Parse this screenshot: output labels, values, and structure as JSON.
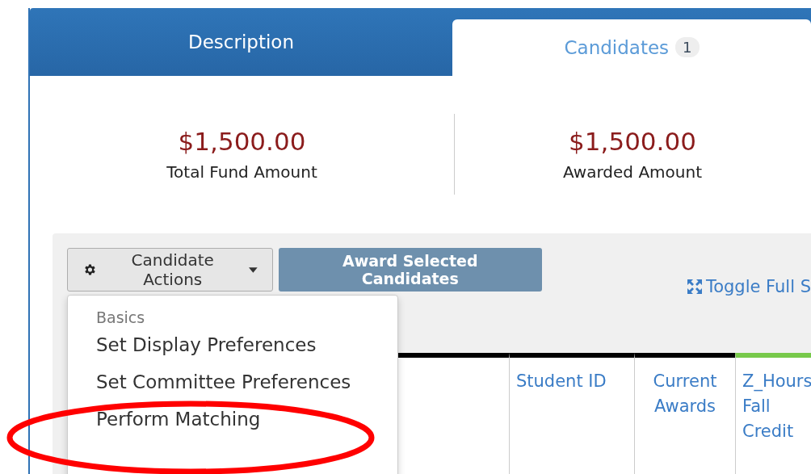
{
  "tabs": [
    {
      "label": "Description",
      "selected": false
    },
    {
      "label": "Candidates",
      "selected": true,
      "badge": "1"
    }
  ],
  "stats": [
    {
      "amount": "$1,500.00",
      "label": "Total Fund Amount"
    },
    {
      "amount": "$1,500.00",
      "label": "Awarded Amount"
    }
  ],
  "actions_button": {
    "label": "Candidate Actions",
    "expanded": true
  },
  "award_button": {
    "label": "Award Selected Candidates",
    "disabled": true
  },
  "toggle_link": "Toggle Full S",
  "menu": {
    "header": "Basics",
    "items": [
      "Set Display Preferences",
      "Set Committee Preferences",
      "Perform Matching"
    ]
  },
  "table": {
    "columns": [
      {
        "label": "Student ID",
        "color": "#000000"
      },
      {
        "label": "Current Awards",
        "color": "#000000"
      },
      {
        "label": "Z_Hours Fall Credit",
        "color": "#77c94a"
      }
    ]
  },
  "annotation": {
    "kind": "ellipse"
  }
}
